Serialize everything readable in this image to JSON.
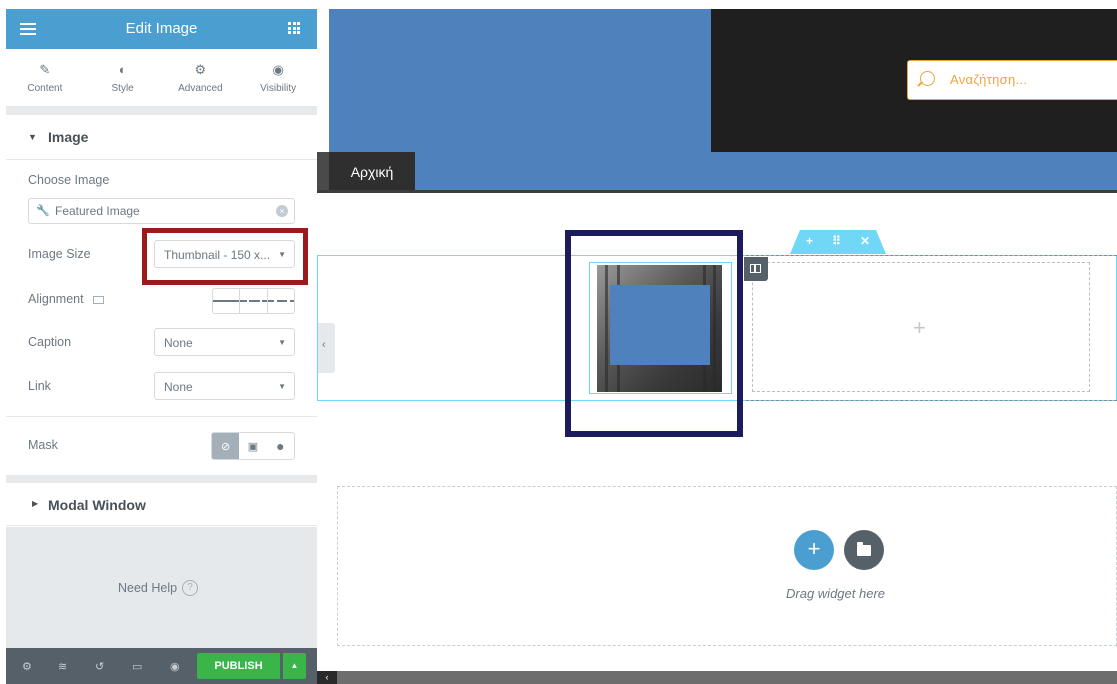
{
  "panel": {
    "title": "Edit Image",
    "tabs": [
      {
        "label": "Content",
        "icon": "pencil-icon"
      },
      {
        "label": "Style",
        "icon": "contrast-icon"
      },
      {
        "label": "Advanced",
        "icon": "gear-icon"
      },
      {
        "label": "Visibility",
        "icon": "eye-icon"
      }
    ],
    "section_image": "Image",
    "choose_image_label": "Choose Image",
    "choose_image_value": "Featured Image",
    "image_size_label": "Image Size",
    "image_size_value": "Thumbnail - 150 x...",
    "alignment_label": "Alignment",
    "caption_label": "Caption",
    "caption_value": "None",
    "link_label": "Link",
    "link_value": "None",
    "mask_label": "Mask",
    "section_modal": "Modal Window",
    "need_help": "Need Help",
    "help_icon_text": "?",
    "publish_label": "PUBLISH"
  },
  "canvas": {
    "search_placeholder": "Αναζήτηση...",
    "nav_item": "Αρχική",
    "drag_widget_text": "Drag widget here",
    "add_symbol": "+"
  },
  "colors": {
    "accent": "#4a9fd0",
    "publish_green": "#39b54a",
    "highlight_red": "#9b1a1a",
    "highlight_navy": "#1c1c5c",
    "placeholder_blue": "#4f81bd",
    "search_orange": "#f0a33a"
  }
}
